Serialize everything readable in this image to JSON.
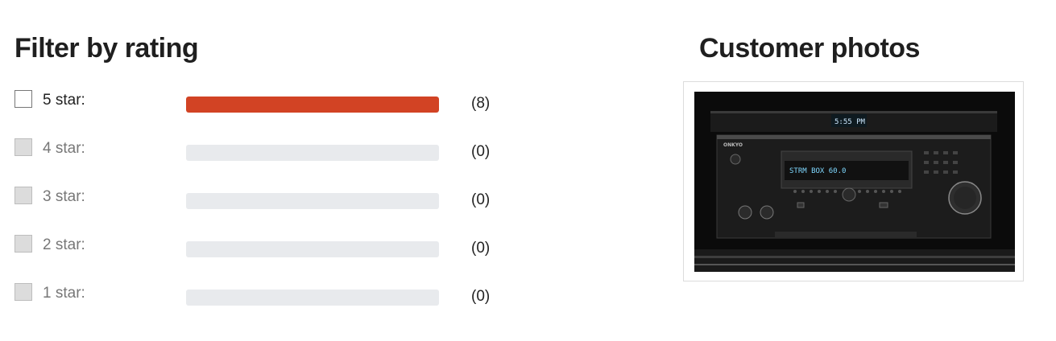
{
  "filter": {
    "title": "Filter by rating",
    "rows": [
      {
        "label": "5 star:",
        "count": "(8)",
        "fraction": 1.0,
        "enabled": true
      },
      {
        "label": "4 star:",
        "count": "(0)",
        "fraction": 0.0,
        "enabled": false
      },
      {
        "label": "3 star:",
        "count": "(0)",
        "fraction": 0.0,
        "enabled": false
      },
      {
        "label": "2 star:",
        "count": "(0)",
        "fraction": 0.0,
        "enabled": false
      },
      {
        "label": "1 star:",
        "count": "(0)",
        "fraction": 0.0,
        "enabled": false
      }
    ],
    "bar_color": "#d24324",
    "track_color": "#e8eaed"
  },
  "photos": {
    "title": "Customer photos",
    "display_text": "STRM BOX  60.0",
    "brand_text": "ONKYO"
  }
}
